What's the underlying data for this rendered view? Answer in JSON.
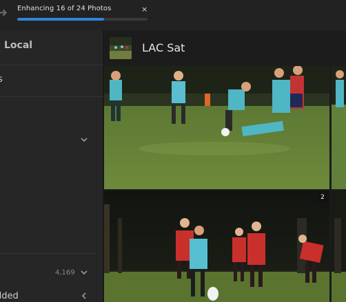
{
  "enhance": {
    "label": "Enhancing 16 of 24 Photos",
    "progress": 0.667,
    "close_glyph": "×"
  },
  "sidebar": {
    "local_label": "Local",
    "item_fragment": "s",
    "count": "4,169",
    "added_fragment": "dded"
  },
  "album": {
    "title": "LAC Sat"
  },
  "grid": {
    "second_photo_badge": "2"
  },
  "colors": {
    "progress": "#2f86d8",
    "background": "#1e1e1e",
    "sidebar": "#262626"
  },
  "icons": [
    "back-arrow-icon",
    "close-icon",
    "chevron-down-icon",
    "chevron-left-icon"
  ]
}
